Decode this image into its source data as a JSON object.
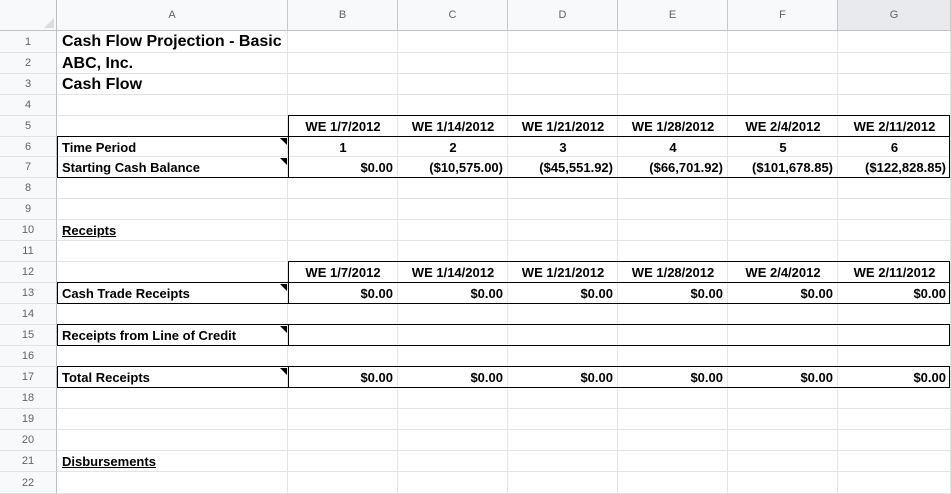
{
  "columns": [
    "A",
    "B",
    "C",
    "D",
    "E",
    "F",
    "G"
  ],
  "rows": [
    "1",
    "2",
    "3",
    "4",
    "5",
    "6",
    "7",
    "8",
    "9",
    "10",
    "11",
    "12",
    "13",
    "14",
    "15",
    "16",
    "17",
    "18",
    "19",
    "20",
    "21",
    "22"
  ],
  "title": {
    "line1": "Cash Flow Projection - Basic",
    "line2": "ABC, Inc.",
    "line3": "Cash Flow"
  },
  "header_dates": [
    "WE 1/7/2012",
    "WE 1/14/2012",
    "WE 1/21/2012",
    "WE 1/28/2012",
    "WE 2/4/2012",
    "WE 2/11/2012"
  ],
  "time_period": {
    "label": "Time Period",
    "values": [
      "1",
      "2",
      "3",
      "4",
      "5",
      "6"
    ]
  },
  "starting_cash": {
    "label": "Starting Cash Balance",
    "values": [
      "$0.00",
      "($10,575.00)",
      "($45,551.92)",
      "($66,701.92)",
      "($101,678.85)",
      "($122,828.85)"
    ]
  },
  "receipts": {
    "heading": "Receipts",
    "header_dates": [
      "WE 1/7/2012",
      "WE 1/14/2012",
      "WE 1/21/2012",
      "WE 1/28/2012",
      "WE 2/4/2012",
      "WE 2/11/2012"
    ],
    "cash_trade": {
      "label": "Cash Trade Receipts",
      "values": [
        "$0.00",
        "$0.00",
        "$0.00",
        "$0.00",
        "$0.00",
        "$0.00"
      ]
    },
    "line_of_credit": {
      "label": "Receipts from Line of Credit"
    },
    "total": {
      "label": "Total Receipts",
      "values": [
        "$0.00",
        "$0.00",
        "$0.00",
        "$0.00",
        "$0.00",
        "$0.00"
      ]
    }
  },
  "disbursements": {
    "heading": "Disbursements"
  }
}
